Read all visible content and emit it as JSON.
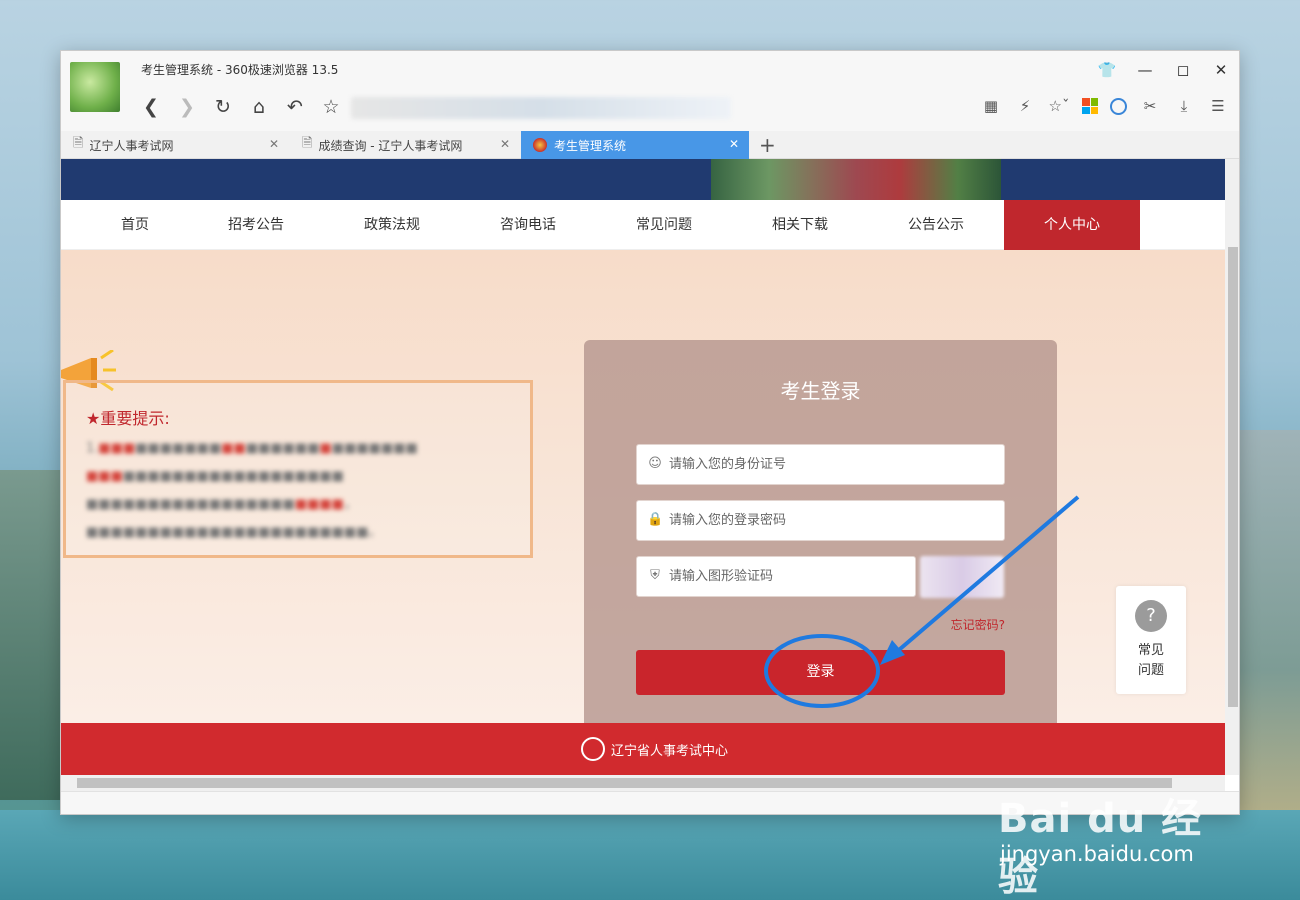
{
  "window": {
    "title": "考生管理系统 - 360极速浏览器 13.5"
  },
  "tabs": [
    {
      "label": "辽宁人事考试网"
    },
    {
      "label": "成绩查询 - 辽宁人事考试网"
    },
    {
      "label": "考生管理系统"
    }
  ],
  "nav": {
    "items": [
      "首页",
      "招考公告",
      "政策法规",
      "咨询电话",
      "常见问题",
      "相关下载",
      "公告公示",
      "个人中心"
    ],
    "active": "个人中心"
  },
  "notice": {
    "title": "重要提示:"
  },
  "login": {
    "title": "考生登录",
    "id_placeholder": "请输入您的身份证号",
    "password_placeholder": "请输入您的登录密码",
    "captcha_placeholder": "请输入图形验证码",
    "forgot": "忘记密码?",
    "button": "登录"
  },
  "faq": {
    "line1": "常见",
    "line2": "问题"
  },
  "footer": {
    "org": "辽宁省人事考试中心"
  },
  "watermark": {
    "brand": "Bai du 经验",
    "url": "jingyan.baidu.com"
  },
  "colors": {
    "brand_red": "#c9252c",
    "nav_blue": "#203a70",
    "annotation_blue": "#1f7ae0",
    "tab_active": "#4897e7"
  },
  "icons": {
    "toolbar": [
      "back-icon",
      "forward-icon",
      "reload-icon",
      "home-icon",
      "undo-icon",
      "star-icon"
    ],
    "right": [
      "qr-icon",
      "flash-icon",
      "bookmark-icon",
      "apps-icon",
      "globe-icon",
      "cut-icon",
      "download-icon",
      "menu-icon"
    ]
  }
}
